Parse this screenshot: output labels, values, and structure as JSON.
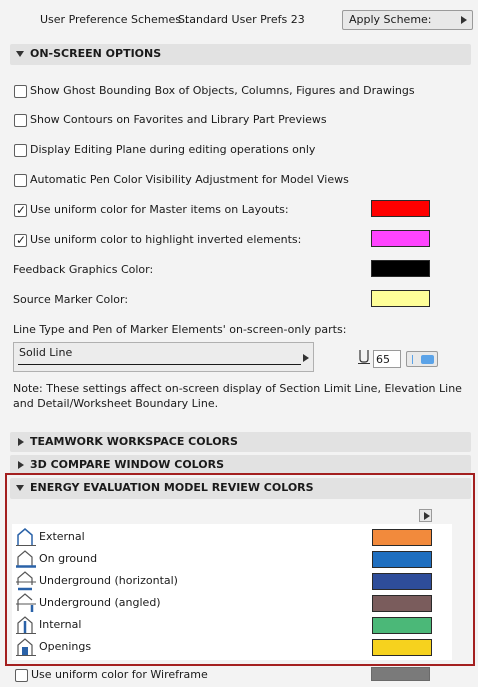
{
  "top": {
    "scheme_label": "User Preference Schemes :",
    "scheme_value": "Standard User Prefs 23",
    "apply_button": "Apply Scheme:"
  },
  "onscreen": {
    "header": "ON-SCREEN OPTIONS",
    "options": [
      {
        "label": "Show Ghost Bounding Box of Objects, Columns, Figures and Drawings",
        "checked": false
      },
      {
        "label": "Show Contours on Favorites and Library Part Previews",
        "checked": false
      },
      {
        "label": "Display Editing Plane during editing operations only",
        "checked": false
      },
      {
        "label": "Automatic Pen Color Visibility Adjustment for Model Views",
        "checked": false
      },
      {
        "label": "Use uniform color for Master items on Layouts:",
        "checked": true,
        "color": "#ff0000"
      },
      {
        "label": "Use uniform color to highlight inverted elements:",
        "checked": true,
        "color": "#ff44ff"
      }
    ],
    "feedback_label": "Feedback Graphics Color:",
    "feedback_color": "#000000",
    "source_label": "Source Marker Color:",
    "source_color": "#ffff99",
    "linetype_label": "Line Type and Pen of Marker Elements' on-screen-only parts:",
    "linetype_value": "Solid Line",
    "pen_number": "65",
    "pen_color": "#5ba3e8",
    "note": "Note: These settings affect on-screen display of Section Limit Line, Elevation Line and Detail/Worksheet Boundary Line."
  },
  "collapsed_sections": [
    {
      "label": "TEAMWORK WORKSPACE COLORS"
    },
    {
      "label": "3D COMPARE WINDOW COLORS"
    }
  ],
  "energy": {
    "header": "ENERGY EVALUATION MODEL REVIEW COLORS",
    "rows": [
      {
        "label": "External",
        "icon": "external-surface-icon",
        "color": "#f28a3c"
      },
      {
        "label": "On ground",
        "icon": "on-ground-surface-icon",
        "color": "#1f6fc0"
      },
      {
        "label": "Underground (horizontal)",
        "icon": "underground-horizontal-icon",
        "color": "#2e4d9a"
      },
      {
        "label": "Underground (angled)",
        "icon": "underground-angled-icon",
        "color": "#7a5c5c"
      },
      {
        "label": "Internal",
        "icon": "internal-surface-icon",
        "color": "#4bb878"
      },
      {
        "label": "Openings",
        "icon": "openings-icon",
        "color": "#f6d21e"
      }
    ],
    "highlight_color": "#a31f1f"
  },
  "wireframe": {
    "label": "Use uniform color for Wireframe",
    "checked": false,
    "color": "#7a7a7a"
  }
}
